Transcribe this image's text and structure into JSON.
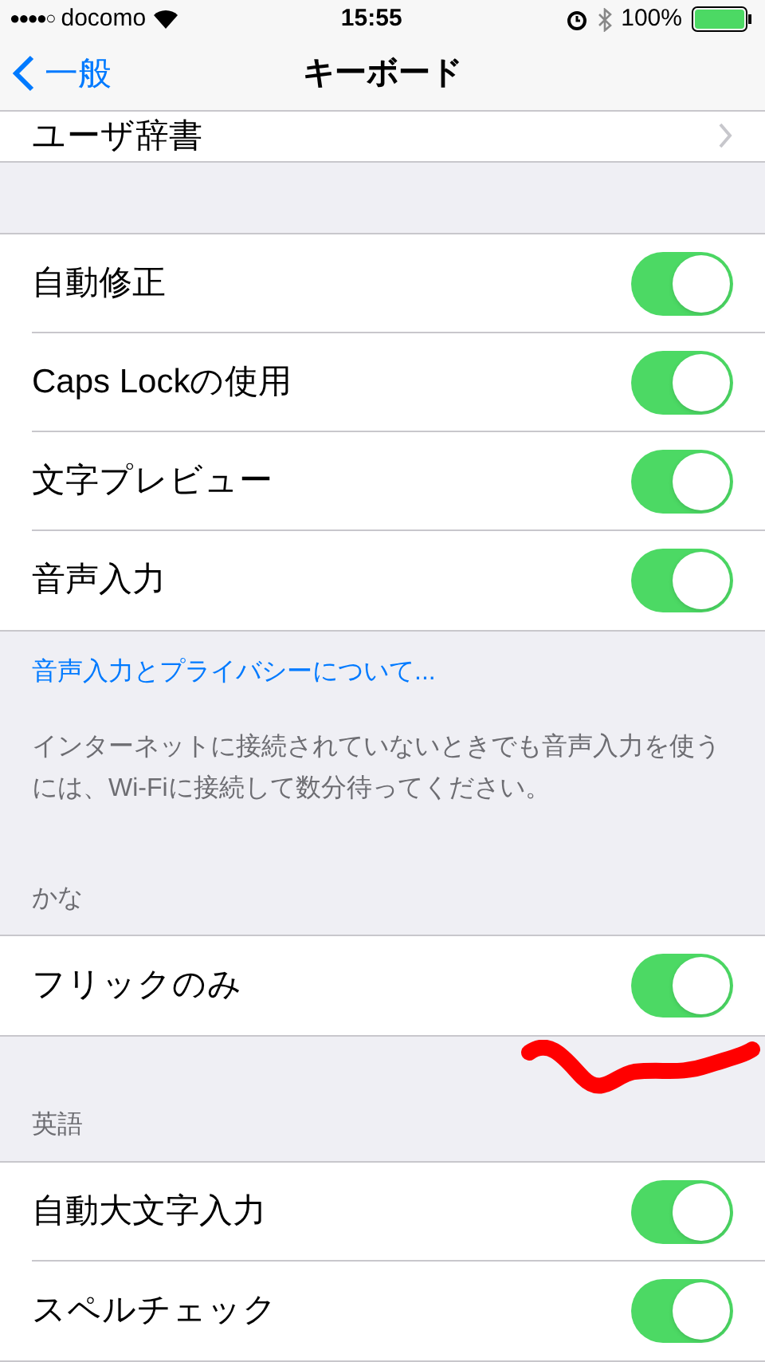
{
  "status_bar": {
    "signal": "●●●●○",
    "carrier": "docomo",
    "time": "15:55",
    "battery": "100%"
  },
  "nav": {
    "back": "一般",
    "title": "キーボード"
  },
  "top_row": {
    "label": "ユーザ辞書"
  },
  "groups": [
    {
      "rows": [
        {
          "label": "自動修正",
          "on": true
        },
        {
          "label": "Caps Lockの使用",
          "on": true
        },
        {
          "label": "文字プレビュー",
          "on": true
        },
        {
          "label": "音声入力",
          "on": true
        }
      ],
      "link": "音声入力とプライバシーについて...",
      "footer": "インターネットに接続されていないときでも音声入力を使うには、Wi-Fiに接続して数分待ってください。"
    },
    {
      "header": "かな",
      "rows": [
        {
          "label": "フリックのみ",
          "on": true
        }
      ]
    },
    {
      "header": "英語",
      "rows": [
        {
          "label": "自動大文字入力",
          "on": true
        },
        {
          "label": "スペルチェック",
          "on": true
        }
      ]
    }
  ]
}
